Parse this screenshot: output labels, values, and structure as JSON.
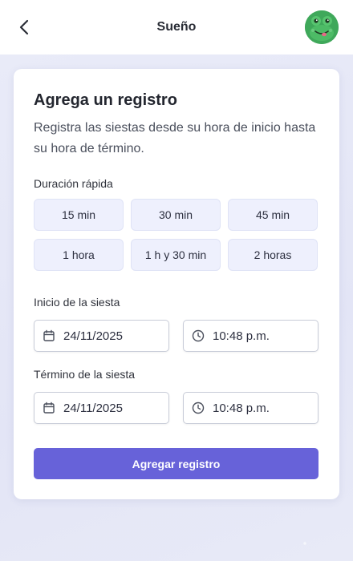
{
  "header": {
    "title": "Sueño",
    "back_icon": "chevron-left-icon",
    "avatar_icon": "frog-avatar-icon"
  },
  "card": {
    "title": "Agrega un registro",
    "description": "Registra las siestas desde su hora de inicio hasta su hora de término.",
    "quick_label": "Duración rápida",
    "quick_options": [
      "15 min",
      "30 min",
      "45 min",
      "1 hora",
      "1 h y 30 min",
      "2 horas"
    ],
    "start": {
      "label": "Inicio de la siesta",
      "date": "24/11/2025",
      "time": "10:48 p.m."
    },
    "end": {
      "label": "Término de la siesta",
      "date": "24/11/2025",
      "time": "10:48 p.m."
    },
    "submit_label": "Agregar registro"
  },
  "colors": {
    "accent": "#6762d9",
    "chip_bg": "#eef0fd",
    "page_bg": "#eceef8",
    "avatar": "#3fa85a"
  }
}
